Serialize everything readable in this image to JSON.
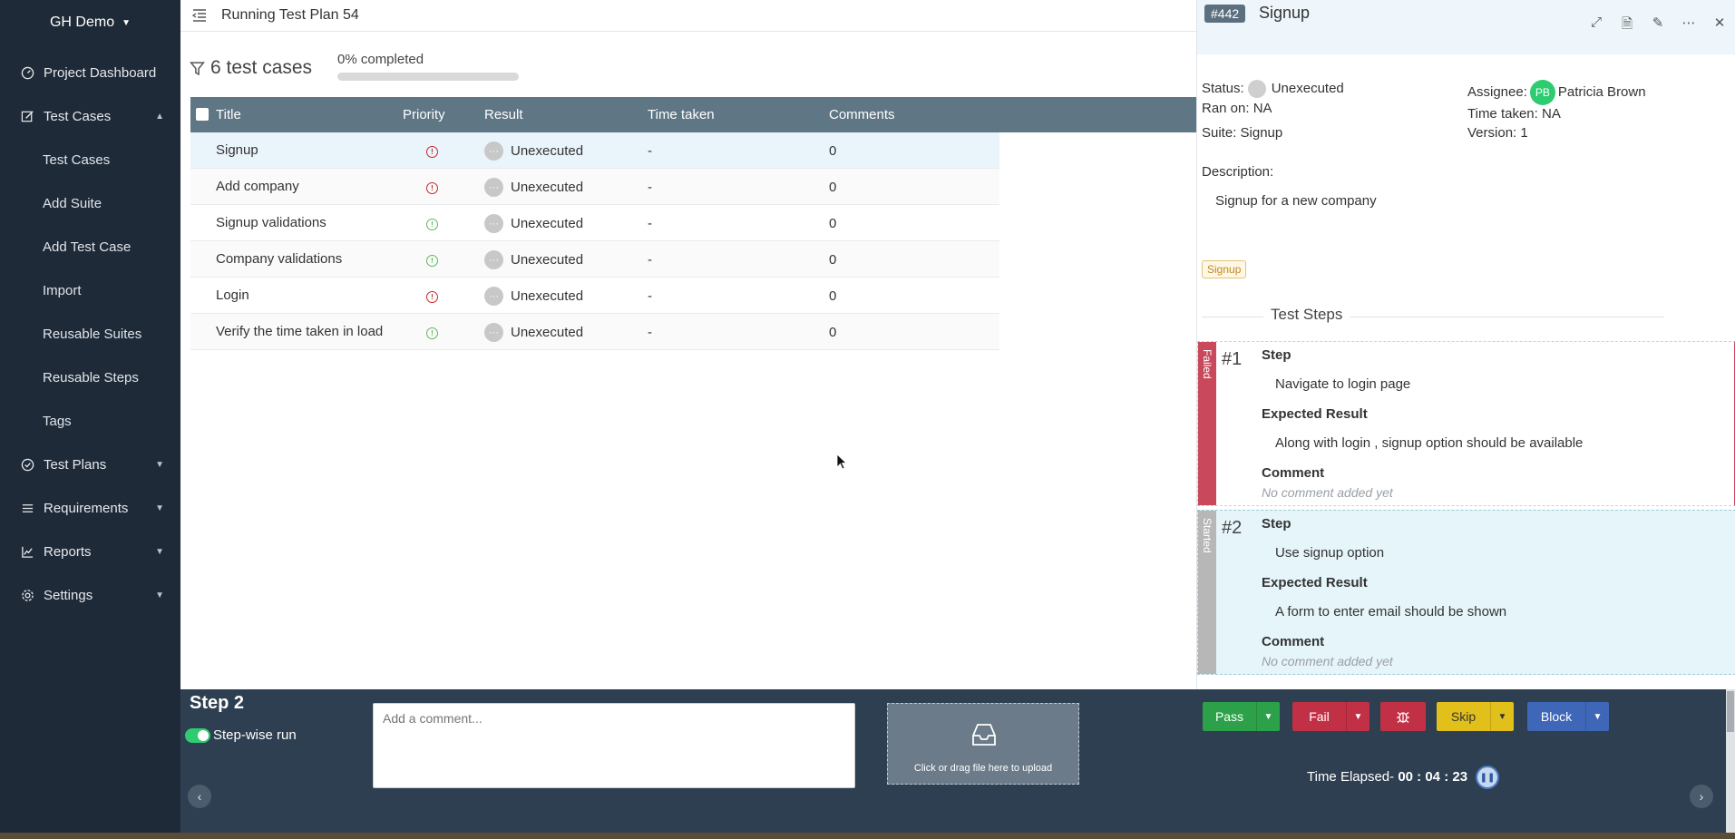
{
  "sidebar": {
    "brand": "GH Demo",
    "items": [
      {
        "label": "Project Dashboard"
      },
      {
        "label": "Test Cases"
      },
      {
        "label": "Test Plans"
      },
      {
        "label": "Requirements"
      },
      {
        "label": "Reports"
      },
      {
        "label": "Settings"
      }
    ],
    "subitems": [
      {
        "label": "Test Cases"
      },
      {
        "label": "Add Suite"
      },
      {
        "label": "Add Test Case"
      },
      {
        "label": "Import"
      },
      {
        "label": "Reusable Suites"
      },
      {
        "label": "Reusable Steps"
      },
      {
        "label": "Tags"
      }
    ]
  },
  "header": {
    "title": "Running Test Plan 54"
  },
  "summary": {
    "count": "6 test cases",
    "progress_label": "0% completed",
    "progress": 0
  },
  "table": {
    "columns": [
      "Title",
      "Priority",
      "Result",
      "Time taken",
      "Comments"
    ],
    "rows": [
      {
        "title": "Signup",
        "priority": "high",
        "result": "Unexecuted",
        "time": "-",
        "comments": "0"
      },
      {
        "title": "Add company",
        "priority": "high",
        "result": "Unexecuted",
        "time": "-",
        "comments": "0"
      },
      {
        "title": "Signup validations",
        "priority": "low",
        "result": "Unexecuted",
        "time": "-",
        "comments": "0"
      },
      {
        "title": "Company validations",
        "priority": "low",
        "result": "Unexecuted",
        "time": "-",
        "comments": "0"
      },
      {
        "title": "Login",
        "priority": "high",
        "result": "Unexecuted",
        "time": "-",
        "comments": "0"
      },
      {
        "title": "Verify the time taken in load",
        "priority": "low",
        "result": "Unexecuted",
        "time": "-",
        "comments": "0"
      }
    ]
  },
  "panel": {
    "id": "#442",
    "title": "Signup",
    "status_label": "Status:",
    "status": "Unexecuted",
    "ran_on_label": "Ran on:",
    "ran_on": "NA",
    "suite_label": "Suite:",
    "suite": "Signup",
    "assignee_label": "Assignee:",
    "assignee_initials": "PB",
    "assignee": "Patricia Brown",
    "time_taken_label": "Time taken:",
    "time_taken": "NA",
    "version_label": "Version:",
    "version": "1",
    "description_label": "Description:",
    "description": "Signup for a new company",
    "tag": "Signup",
    "steps_title": "Test Steps",
    "steps": [
      {
        "num": "#1",
        "state": "Failed",
        "step_label": "Step",
        "step": "Navigate to login page",
        "expected_label": "Expected Result",
        "expected": "Along with login , signup option should be available",
        "comment_label": "Comment",
        "comment": "No comment added yet"
      },
      {
        "num": "#2",
        "state": "Started",
        "step_label": "Step",
        "step": "Use signup option",
        "expected_label": "Expected Result",
        "expected": "A form to enter email should be shown",
        "comment_label": "Comment",
        "comment": "No comment added yet"
      }
    ]
  },
  "bottom": {
    "step_label": "Step 2",
    "stepwise_label": "Step-wise run",
    "comment_placeholder": "Add a comment...",
    "upload_label": "Click or drag file here to upload",
    "pass": "Pass",
    "fail": "Fail",
    "skip": "Skip",
    "block": "Block",
    "elapsed_label": "Time Elapsed-",
    "elapsed": "00 : 04 : 23"
  },
  "colors": {
    "sidebar": "#1f2a38",
    "table_header": "#5f7685",
    "bottom_bar": "#2e3f51",
    "pass": "#2ca14a",
    "fail": "#c13045",
    "skip": "#e2c01c",
    "block": "#3f67b8"
  }
}
